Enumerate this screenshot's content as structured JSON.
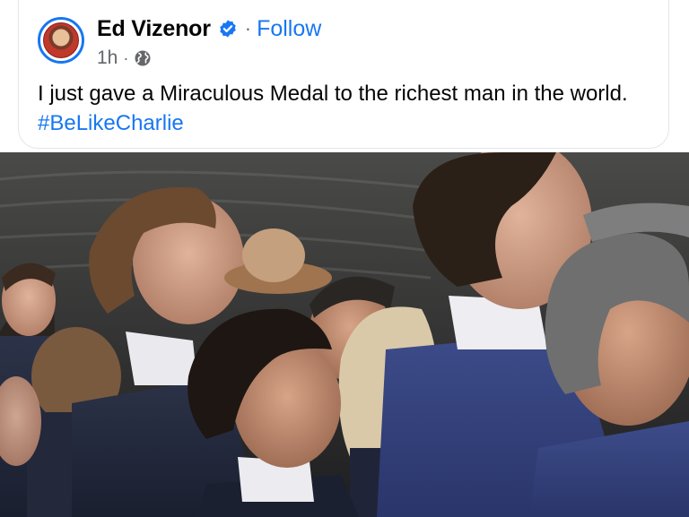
{
  "post": {
    "author_name": "Ed Vizenor",
    "separator": "·",
    "follow_label": "Follow",
    "time": "1h",
    "meta_separator": "·",
    "privacy_icon": "globe-icon",
    "verified_icon": "verified-badge-icon",
    "text_main": "I just gave a Miraculous Medal to the richest man in the world.",
    "hashtag": "#BeLikeCharlie"
  },
  "colors": {
    "link_blue": "#1877f2",
    "text_primary": "#050505",
    "text_secondary": "#65676b",
    "border": "#e4e6eb"
  }
}
